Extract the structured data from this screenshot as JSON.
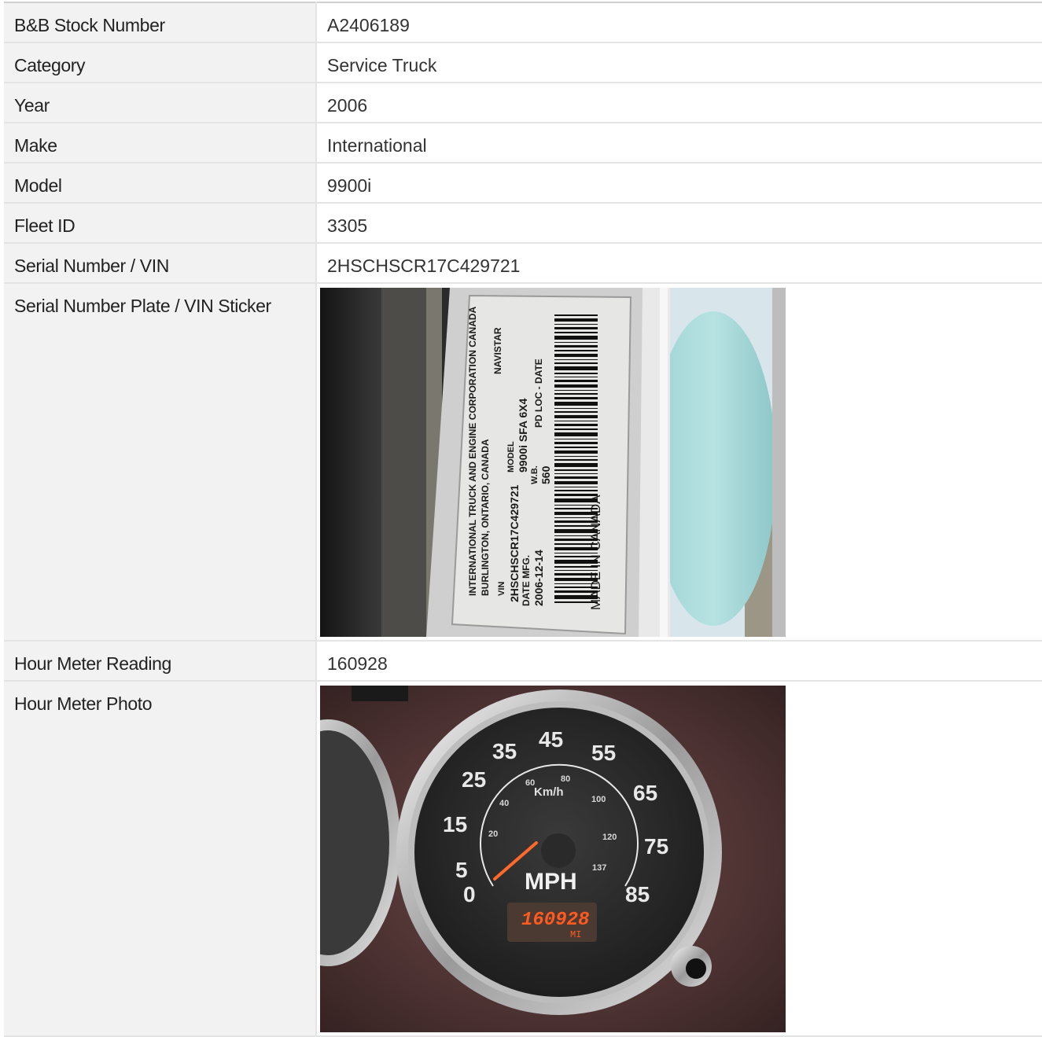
{
  "rows": [
    {
      "label": "B&B Stock Number",
      "value": "A2406189"
    },
    {
      "label": "Category",
      "value": "Service Truck"
    },
    {
      "label": "Year",
      "value": "2006"
    },
    {
      "label": "Make",
      "value": "International"
    },
    {
      "label": "Model",
      "value": "9900i"
    },
    {
      "label": "Fleet ID",
      "value": "3305"
    },
    {
      "label": "Serial Number / VIN",
      "value": "2HSCHSCR17C429721"
    }
  ],
  "vin_photo": {
    "label": "Serial Number Plate / VIN Sticker",
    "sticker": {
      "line1": "INTERNATIONAL TRUCK AND ENGINE CORPORATION CANADA",
      "line2": "BURLINGTON, ONTARIO, CANADA",
      "brand": "NAVISTAR",
      "vin_label": "VIN",
      "vin": "2HSCHSCR17C429721",
      "model_label": "MODEL",
      "model": "9900i SFA 6X4",
      "date_label": "DATE MFG.",
      "date": "2006-12-14",
      "wb_label": "W.B.",
      "wb": "560",
      "pd_label": "PD LOC - DATE",
      "made_in": "MADE IN CANADA"
    }
  },
  "hour_meter": {
    "label": "Hour Meter Reading",
    "value": "160928"
  },
  "meter_photo": {
    "label": "Hour Meter Photo",
    "gauge": {
      "mph_ticks": [
        "0",
        "5",
        "15",
        "25",
        "35",
        "45",
        "55",
        "65",
        "75",
        "85"
      ],
      "kmh_ticks": [
        "20",
        "40",
        "60",
        "80",
        "100",
        "120",
        "137"
      ],
      "unit_main": "MPH",
      "unit_inner": "Km/h",
      "odometer": "160928",
      "odometer_unit": "MI"
    }
  },
  "colors": {
    "label_bg": "#f2f2f2",
    "border": "#e4e4e4",
    "odometer": "#ff5a1f"
  }
}
